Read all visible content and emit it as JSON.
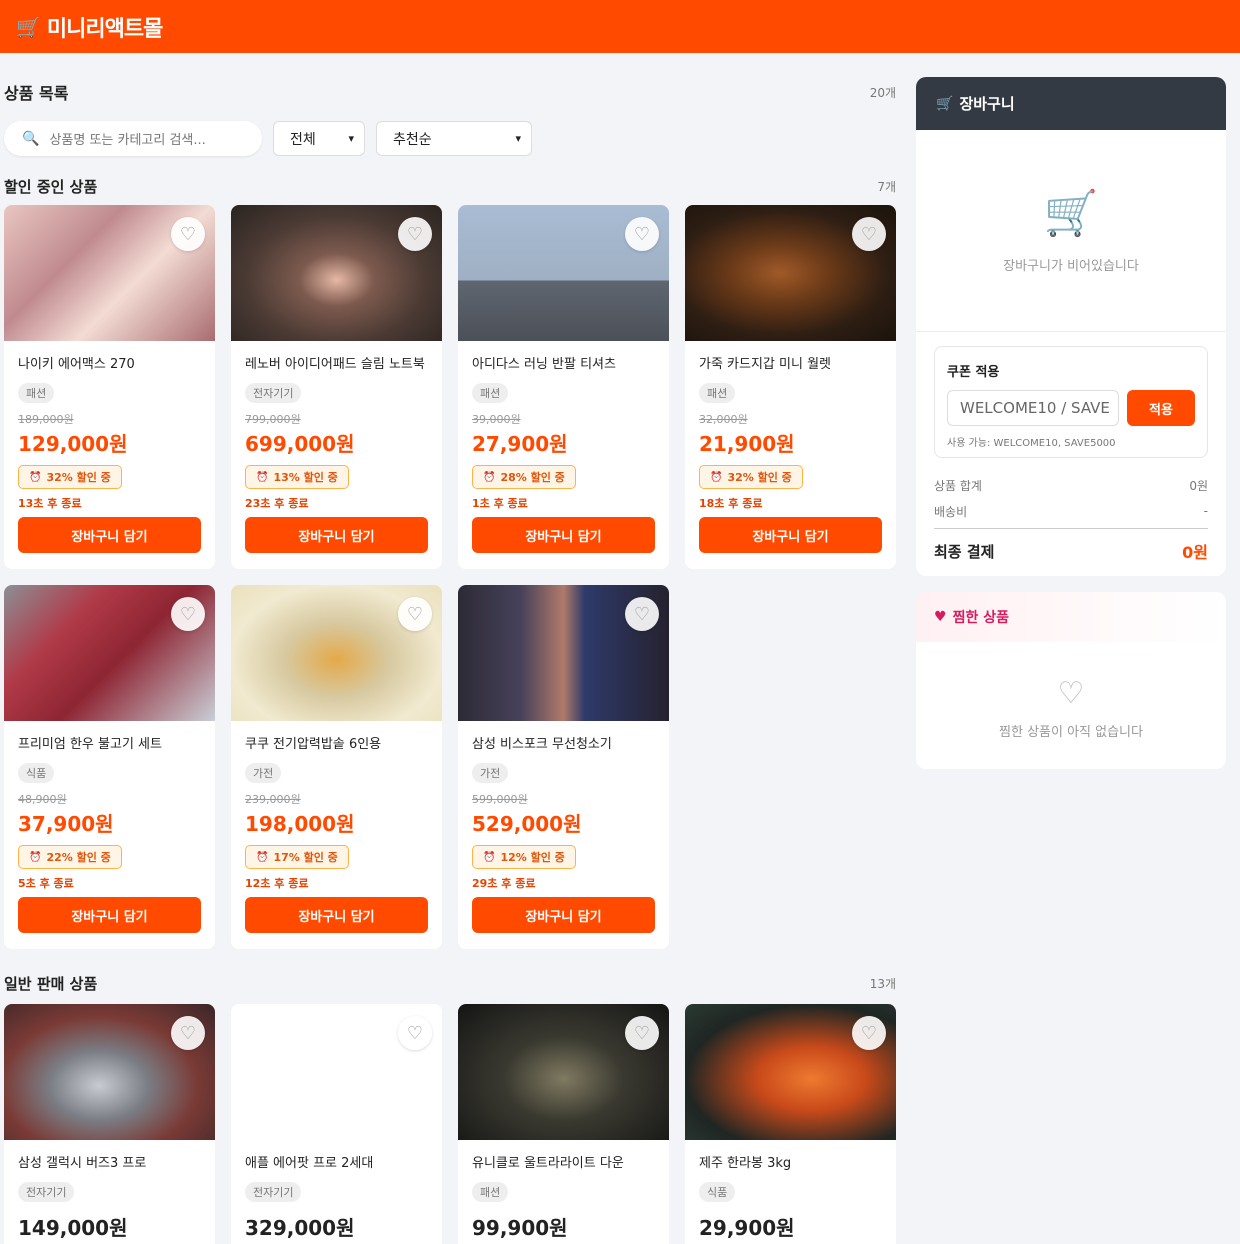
{
  "header": {
    "logo_icon": "shopping-cart-icon",
    "title": "미니리액트몰"
  },
  "list": {
    "title": "상품 목록",
    "count": "20개"
  },
  "search": {
    "placeholder": "상품명 또는 카테고리 검색..."
  },
  "filters": {
    "category": "전체",
    "sort": "추천순"
  },
  "sale_section": {
    "title": "할인 중인 상품",
    "count": "7개"
  },
  "normal_section": {
    "title": "일반 판매 상품",
    "count": "13개"
  },
  "sale_products": [
    {
      "name": "나이키 에어맥스 270",
      "category": "패션",
      "original": "189,000원",
      "price": "129,000원",
      "discount": "32% 할인 중",
      "timer": "13초 후 종료",
      "cta": "장바구니 담기"
    },
    {
      "name": "레노버 아이디어패드 슬림 노트북",
      "category": "전자기기",
      "original": "799,000원",
      "price": "699,000원",
      "discount": "13% 할인 중",
      "timer": "23초 후 종료",
      "cta": "장바구니 담기"
    },
    {
      "name": "아디다스 러닝 반팔 티셔츠",
      "category": "패션",
      "original": "39,000원",
      "price": "27,900원",
      "discount": "28% 할인 중",
      "timer": "1초 후 종료",
      "cta": "장바구니 담기"
    },
    {
      "name": "가죽 카드지갑 미니 월렛",
      "category": "패션",
      "original": "32,000원",
      "price": "21,900원",
      "discount": "32% 할인 중",
      "timer": "18초 후 종료",
      "cta": "장바구니 담기"
    },
    {
      "name": "프리미엄 한우 불고기 세트",
      "category": "식품",
      "original": "48,900원",
      "price": "37,900원",
      "discount": "22% 할인 중",
      "timer": "5초 후 종료",
      "cta": "장바구니 담기"
    },
    {
      "name": "쿠쿠 전기압력밥솥 6인용",
      "category": "가전",
      "original": "239,000원",
      "price": "198,000원",
      "discount": "17% 할인 중",
      "timer": "12초 후 종료",
      "cta": "장바구니 담기"
    },
    {
      "name": "삼성 비스포크 무선청소기",
      "category": "가전",
      "original": "599,000원",
      "price": "529,000원",
      "discount": "12% 할인 중",
      "timer": "29초 후 종료",
      "cta": "장바구니 담기"
    }
  ],
  "normal_products": [
    {
      "name": "삼성 갤럭시 버즈3 프로",
      "category": "전자기기",
      "price": "149,000원"
    },
    {
      "name": "애플 에어팟 프로 2세대",
      "category": "전자기기",
      "price": "329,000원"
    },
    {
      "name": "유니클로 울트라라이트 다운",
      "category": "패션",
      "price": "99,900원"
    },
    {
      "name": "제주 한라봉 3kg",
      "category": "식품",
      "price": "29,900원"
    }
  ],
  "cart": {
    "title": "장바구니",
    "empty_text": "장바구니가 비어있습니다",
    "coupon_title": "쿠폰 적용",
    "coupon_placeholder": "WELCOME10 / SAVE",
    "coupon_apply": "적용",
    "coupon_hint": "사용 가능: WELCOME10, SAVE5000",
    "subtotal_label": "상품 합계",
    "subtotal_value": "0원",
    "shipping_label": "배송비",
    "shipping_value": "-",
    "total_label": "최종 결제",
    "total_value": "0원"
  },
  "wishlist": {
    "title": "찜한 상품",
    "empty_text": "찜한 상품이 아직 없습니다"
  },
  "colors": {
    "brand": "#ff4a00",
    "cart_header": "#343a44",
    "wish_accent": "#d81b60"
  }
}
